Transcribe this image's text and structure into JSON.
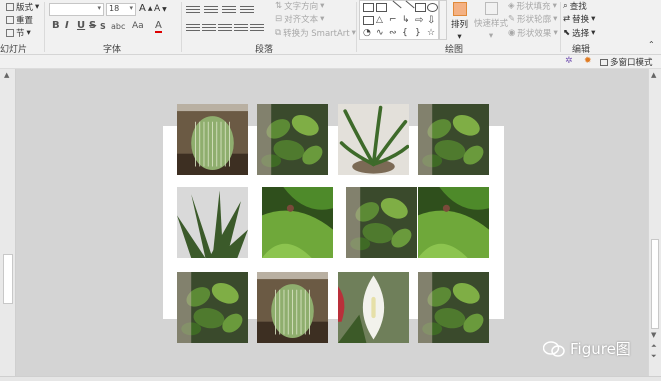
{
  "ribbon": {
    "slides_group": {
      "layout": "版式",
      "reset": "重置",
      "section": "节",
      "label": "幻灯片"
    },
    "font_group": {
      "size": "18",
      "grow": "A",
      "shrink": "A",
      "bold": "B",
      "italic": "I",
      "underline": "U",
      "strike": "S",
      "spacing": "abc",
      "case": "Aa",
      "color": "A",
      "label": "字体"
    },
    "para_group": {
      "text_direction": "文字方向",
      "align_text": "对齐文本",
      "smartart": "转换为 SmartArt",
      "label": "段落"
    },
    "draw_group": {
      "arrange": "排列",
      "quick_styles": "快速样式",
      "shape_fill": "形状填充",
      "shape_outline": "形状轮廓",
      "shape_effects": "形状效果",
      "label": "绘图"
    },
    "edit_group": {
      "find": "查找",
      "replace": "替换",
      "select": "选择",
      "label": "编辑"
    }
  },
  "toolbar2": {
    "multi_window": "多窗口模式"
  },
  "watermark": {
    "text": "Figure图"
  },
  "colors": {
    "ribbon_bg": "#f1f1f1",
    "canvas_bg": "#d4d4d4",
    "slide_bg": "#ffffff"
  },
  "slide": {
    "photos": [
      {
        "subject": "cactus"
      },
      {
        "subject": "green plant"
      },
      {
        "subject": "spider plant"
      },
      {
        "subject": "green plant"
      },
      {
        "subject": "snake plant"
      },
      {
        "subject": "leaf close-up"
      },
      {
        "subject": "green plant"
      },
      {
        "subject": "leaf close-up"
      },
      {
        "subject": "green plant"
      },
      {
        "subject": "cactus"
      },
      {
        "subject": "peace lily"
      },
      {
        "subject": "green plant"
      }
    ]
  }
}
